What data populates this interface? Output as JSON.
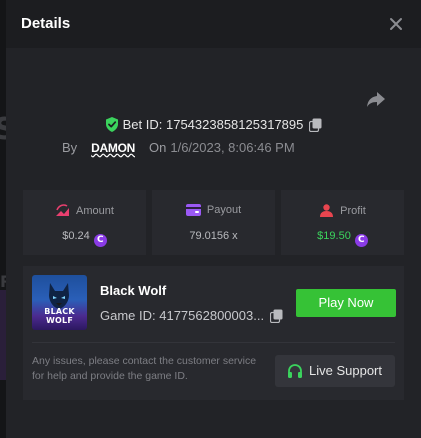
{
  "modal": {
    "title": "Details"
  },
  "bet": {
    "id_label": "Bet ID: 1754323858125317895",
    "by_label": "By",
    "username": "DAMON",
    "on_label": "On",
    "timestamp": "1/6/2023, 8:06:46 PM"
  },
  "stats": {
    "amount": {
      "label": "Amount",
      "value": "$0.24"
    },
    "payout": {
      "label": "Payout",
      "value": "79.0156 x"
    },
    "profit": {
      "label": "Profit",
      "value": "$19.50"
    }
  },
  "game": {
    "name": "Black Wolf",
    "thumb_text": "BLACK WOLF",
    "id_label": "Game ID: 4177562800003...",
    "play_label": "Play Now",
    "issue_text": "Any issues, please contact the customer service for help and provide the game ID.",
    "support_label": "Live Support"
  },
  "currency_symbol": "C",
  "colors": {
    "accent_green": "#36c236",
    "profit_green": "#3bd35d",
    "amount_icon": "#e83f6f",
    "payout_icon": "#9b59f5",
    "profit_icon": "#e8454f",
    "coin": "#8a3be6",
    "verified_shield": "#3bd35d"
  },
  "icons": {
    "close": "close-icon",
    "share": "share-icon",
    "shield": "verified-shield-icon",
    "copy": "copy-icon",
    "amount": "amount-icon",
    "payout": "wallet-icon",
    "profit": "profit-user-icon",
    "coin": "currency-coin-icon",
    "support": "headset-icon"
  }
}
